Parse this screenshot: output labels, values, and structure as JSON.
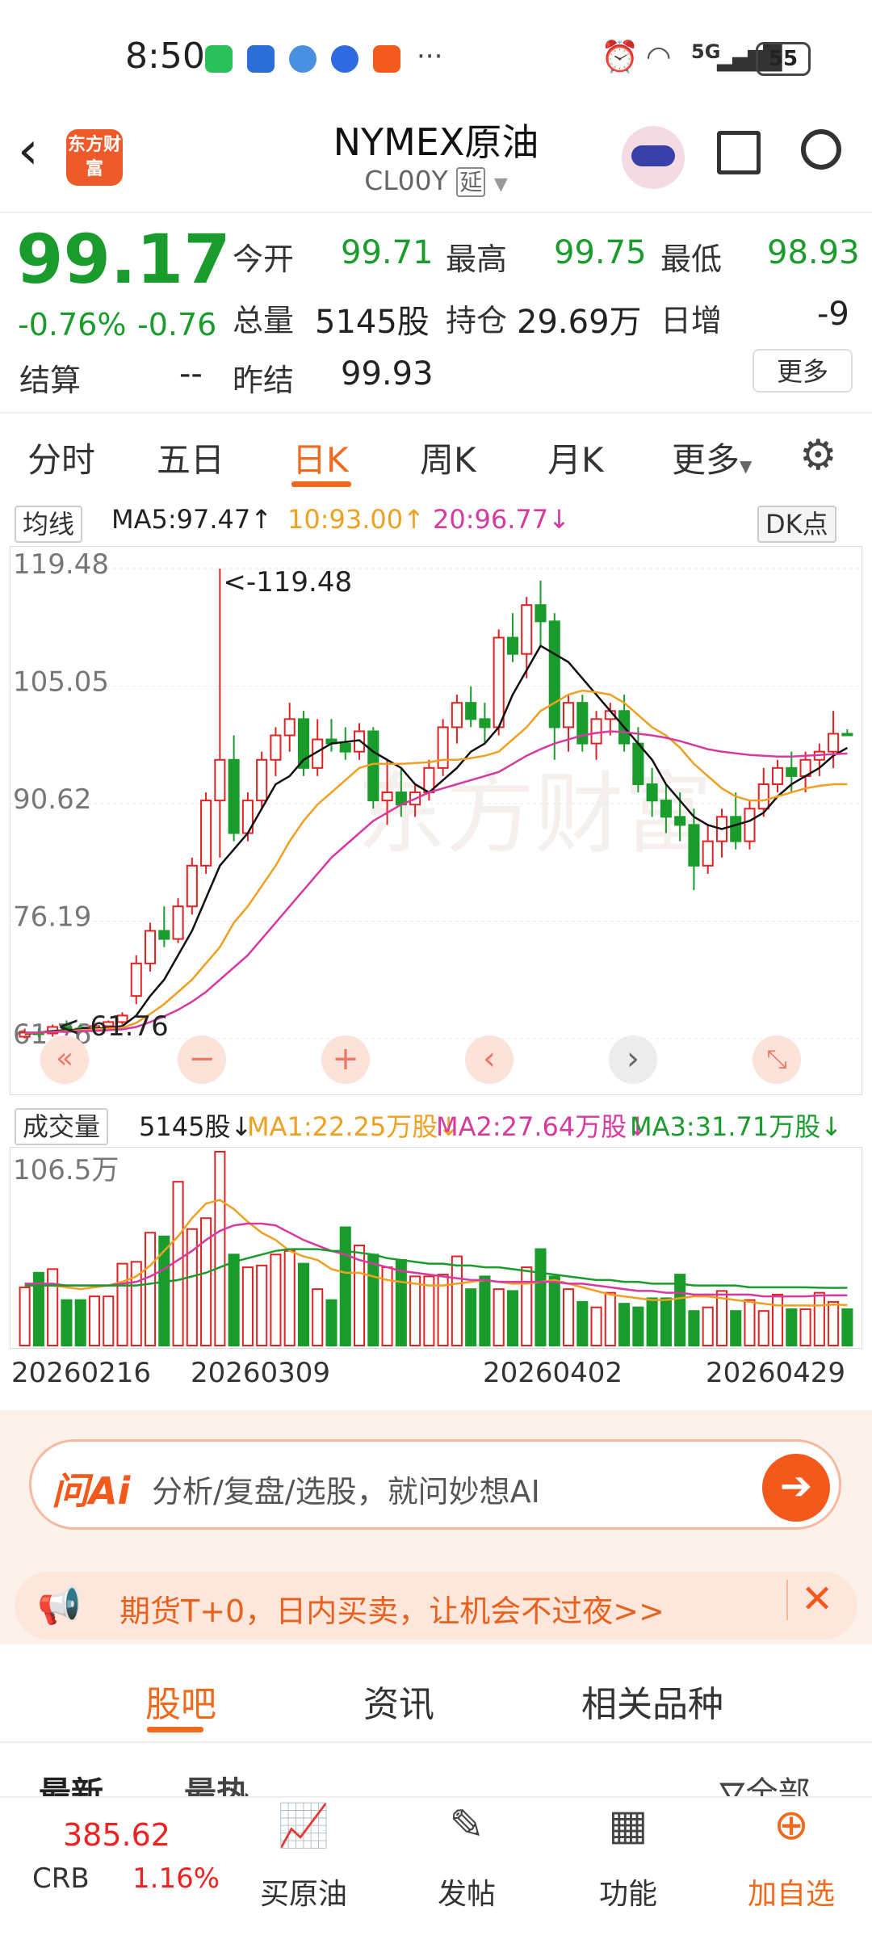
{
  "status_bar": {
    "time": "8:50",
    "battery": "55",
    "network": "5G"
  },
  "header": {
    "title": "NYMEX原油",
    "code": "CL00Y",
    "delay_badge": "延",
    "logo_text": "东方财富",
    "back_icon": "back-chevron-icon",
    "share_icon": "share-icon",
    "search_icon": "search-icon"
  },
  "quote": {
    "price": "99.17",
    "change_pct": "-0.76%",
    "change": "-0.76",
    "open_label": "今开",
    "open": "99.71",
    "high_label": "最高",
    "high": "99.75",
    "low_label": "最低",
    "low": "98.93",
    "volume_label": "总量",
    "volume": "5145股",
    "position_label": "持仓",
    "position": "29.69万",
    "daily_inc_label": "日增",
    "daily_inc": "-9",
    "settle_label": "结算",
    "settle": "--",
    "prev_settle_label": "昨结",
    "prev_settle": "99.93",
    "more_label": "更多"
  },
  "tabs": {
    "items": [
      "分时",
      "五日",
      "日K",
      "周K",
      "月K",
      "更多"
    ],
    "active": "日K"
  },
  "ma_line": {
    "selector": "均线",
    "ma5": "MA5:97.47↑",
    "ma10": "10:93.00↑",
    "ma20": "20:96.77↓",
    "dk": "DK点"
  },
  "vol_line": {
    "selector": "成交量",
    "vol": "5145股↓",
    "ma1": "MA1:22.25万股↓",
    "ma2": "MA2:27.64万股↓",
    "ma3": "MA3:31.71万股↓"
  },
  "colors": {
    "up": "#e22222",
    "down": "#1a9c2d",
    "ma5": "#111111",
    "ma10": "#f0a020",
    "ma20": "#d63aa0",
    "accent": "#f06a1d"
  },
  "chart_data": {
    "type": "candlestick",
    "y_ticks": [
      "119.48",
      "105.05",
      "90.62",
      "76.19",
      "61.76"
    ],
    "ylim": [
      61.76,
      119.48
    ],
    "max_marker": "<-119.48",
    "min_marker": "<-61.76",
    "candles": [
      [
        62,
        63,
        61.8,
        62.5
      ],
      [
        62.5,
        63,
        62,
        62.4
      ],
      [
        62.4,
        63.5,
        62,
        63.2
      ],
      [
        63.2,
        64,
        62.8,
        63
      ],
      [
        63,
        63.6,
        62.5,
        62.8
      ],
      [
        62.8,
        63.5,
        62.5,
        63.3
      ],
      [
        63.3,
        64,
        63,
        63.8
      ],
      [
        63.8,
        65,
        63.5,
        64.6
      ],
      [
        67,
        72,
        66,
        71
      ],
      [
        71,
        76,
        70,
        75
      ],
      [
        75,
        78,
        73,
        74
      ],
      [
        74,
        79,
        73.5,
        78
      ],
      [
        78,
        84,
        77,
        83
      ],
      [
        83,
        92,
        82,
        91
      ],
      [
        91,
        119.48,
        84,
        96
      ],
      [
        96,
        99,
        86,
        87
      ],
      [
        87,
        92,
        86,
        91
      ],
      [
        91,
        97,
        90,
        96
      ],
      [
        96,
        100,
        94,
        99
      ],
      [
        99,
        103,
        97,
        101
      ],
      [
        101,
        102,
        94,
        95
      ],
      [
        95,
        101,
        94,
        98.5
      ],
      [
        98.5,
        101,
        97,
        98
      ],
      [
        98,
        100,
        96,
        97
      ],
      [
        97,
        100.5,
        96,
        99.5
      ],
      [
        99.5,
        100,
        90,
        91
      ],
      [
        91,
        96,
        88,
        92
      ],
      [
        92,
        95,
        89,
        90.5
      ],
      [
        90.5,
        93,
        89,
        92
      ],
      [
        92,
        96,
        91,
        95
      ],
      [
        95,
        101,
        94,
        100
      ],
      [
        100,
        104,
        98,
        103
      ],
      [
        103,
        105,
        100,
        101
      ],
      [
        101,
        103,
        98,
        100
      ],
      [
        100,
        112,
        99,
        111
      ],
      [
        111,
        114,
        108,
        109
      ],
      [
        109,
        116,
        106,
        115
      ],
      [
        115,
        118,
        110,
        113
      ],
      [
        113,
        114,
        96,
        100
      ],
      [
        100,
        104,
        97,
        103
      ],
      [
        103,
        104,
        97,
        98
      ],
      [
        98,
        102,
        96,
        101
      ],
      [
        101,
        103,
        99,
        102
      ],
      [
        102,
        104,
        97,
        98
      ],
      [
        98,
        100,
        92,
        93
      ],
      [
        93,
        95,
        89,
        91
      ],
      [
        91,
        93,
        87,
        89
      ],
      [
        89,
        92,
        86,
        88
      ],
      [
        88,
        90,
        80,
        83
      ],
      [
        83,
        88,
        82,
        86
      ],
      [
        86,
        90,
        84,
        89
      ],
      [
        89,
        92,
        85,
        86
      ],
      [
        86,
        91,
        85,
        90
      ],
      [
        90,
        95,
        89,
        93
      ],
      [
        93,
        96,
        92,
        95
      ],
      [
        95,
        97,
        92,
        94
      ],
      [
        94,
        97,
        92,
        96
      ],
      [
        96,
        98,
        94,
        97
      ],
      [
        97,
        102,
        95,
        99.2
      ],
      [
        99.2,
        99.75,
        98.93,
        99.17
      ]
    ],
    "ma5": [
      62.3,
      62.5,
      62.7,
      62.8,
      62.9,
      63,
      63.1,
      63.3,
      64.6,
      67,
      69,
      72,
      75,
      79,
      83,
      85,
      87,
      90,
      93,
      94,
      96,
      97,
      98,
      98.2,
      98.4,
      97,
      96,
      95,
      93,
      92,
      93.5,
      95,
      97,
      98,
      100,
      104,
      107,
      110,
      109,
      108,
      106,
      104,
      102,
      100,
      98,
      96,
      93,
      91,
      89,
      88,
      87.5,
      88,
      88.5,
      89.5,
      91.5,
      93,
      94,
      95,
      96.5,
      97.47
    ],
    "ma10": [
      62.4,
      62.5,
      62.6,
      62.7,
      62.8,
      62.9,
      63,
      63.1,
      63.7,
      64.8,
      66,
      67.5,
      69,
      71,
      73,
      76,
      78,
      80.5,
      83,
      86,
      88.5,
      90.5,
      92,
      93.5,
      95,
      95.5,
      95.5,
      95.5,
      95.6,
      95.7,
      96,
      96,
      96.2,
      96.5,
      97,
      98.5,
      100,
      102,
      103,
      104,
      104.5,
      104.3,
      104,
      103,
      101.5,
      100,
      99,
      97.5,
      95.5,
      94,
      92.5,
      91.5,
      91,
      91,
      91.5,
      92,
      92.5,
      92.8,
      93,
      93.0
    ],
    "ma20": [
      62.5,
      62.5,
      62.6,
      62.6,
      62.7,
      62.7,
      62.8,
      62.9,
      63.2,
      63.8,
      64.5,
      65.3,
      66.3,
      67.5,
      69,
      70.5,
      72,
      74,
      76,
      78,
      80,
      82,
      84,
      85.5,
      87,
      88.5,
      89.5,
      90.5,
      91.2,
      92,
      92.5,
      93,
      93.5,
      94,
      94.5,
      95.5,
      96.5,
      97.3,
      98,
      98.5,
      99,
      99.3,
      99.5,
      99.4,
      99.2,
      99,
      98.7,
      98.3,
      97.8,
      97.3,
      97,
      96.8,
      96.6,
      96.5,
      96.4,
      96.4,
      96.5,
      96.6,
      96.7,
      96.77
    ],
    "volume_max_label": "106.5万",
    "volume": [
      32,
      40,
      42,
      25,
      25,
      27,
      27,
      45,
      46,
      62,
      60,
      90,
      64,
      70,
      106.5,
      50,
      43,
      44,
      50,
      52,
      45,
      31,
      25,
      65,
      55,
      50,
      43,
      47,
      38,
      38,
      39,
      49,
      31,
      38,
      31,
      30,
      43,
      53,
      38,
      31,
      24,
      21,
      29,
      23,
      21,
      26,
      26,
      39,
      19,
      21,
      30,
      19,
      25,
      19,
      28,
      20,
      20,
      29,
      24,
      20
    ],
    "vol_ma1": [
      34,
      34,
      33,
      32,
      31,
      32,
      33,
      35,
      38,
      44,
      52,
      60,
      70,
      78,
      80,
      75,
      68,
      62,
      58,
      52,
      49,
      47,
      42,
      40,
      40,
      38,
      36,
      35,
      34,
      33,
      33,
      34,
      35,
      36,
      35,
      34,
      34,
      35,
      36,
      34,
      32,
      30,
      28,
      27,
      26,
      25,
      25,
      26,
      27,
      27,
      26,
      25,
      24,
      23,
      22,
      22,
      22,
      22,
      22.5,
      22.25
    ],
    "vol_ma2": [
      34,
      34,
      34,
      33,
      33,
      33,
      33,
      34,
      35,
      38,
      42,
      47,
      52,
      58,
      63,
      66,
      67,
      67,
      66,
      62,
      58,
      55,
      52,
      50,
      47,
      45,
      43,
      41,
      40,
      39,
      38,
      37,
      36,
      36,
      35,
      35,
      35,
      35,
      35,
      34,
      34,
      33,
      32,
      31,
      30,
      30,
      29,
      29,
      28,
      28,
      28,
      28,
      28,
      27,
      27,
      27,
      27,
      27.5,
      27.6,
      27.64
    ],
    "vol_ma3": [
      33,
      33,
      33,
      33,
      33,
      33,
      33,
      33,
      33,
      34,
      35,
      36,
      38,
      40,
      43,
      46,
      48,
      50,
      52,
      53,
      53,
      53,
      52,
      52,
      51,
      50,
      48,
      47,
      46,
      45,
      45,
      44,
      44,
      43,
      43,
      42,
      41,
      40,
      39,
      38,
      37,
      36,
      36,
      35,
      35,
      34,
      34,
      34,
      33,
      33,
      33,
      33,
      32,
      32,
      32,
      32,
      32,
      31.8,
      31.7,
      31.71
    ],
    "dates": [
      "20260216",
      "20260309",
      "20260402",
      "20260429"
    ]
  },
  "ai_bar": {
    "logo": "问Ai",
    "placeholder": "分析/复盘/选股，就问妙想AI"
  },
  "promo": {
    "text": "期货T+0，日内买卖，让机会不过夜>>"
  },
  "section_tabs": {
    "items": [
      "股吧",
      "资讯",
      "相关品种"
    ],
    "active": "股吧"
  },
  "sub_tabs": {
    "latest": "最新",
    "hot": "最热",
    "all": "全部"
  },
  "bottom_nav": {
    "crb_value": "385.62",
    "crb_label": "CRB",
    "crb_change": "1.16%",
    "items": [
      "买原油",
      "发帖",
      "功能",
      "加自选"
    ]
  }
}
